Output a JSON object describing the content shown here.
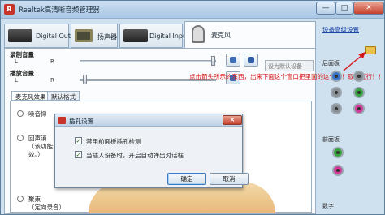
{
  "window": {
    "title": "Realtek高清晰音频管理器"
  },
  "device_tabs": [
    {
      "label": "Digital Output"
    },
    {
      "label": "扬声器"
    },
    {
      "label": "Digital Input"
    },
    {
      "label": "麦克风"
    }
  ],
  "right_panel": {
    "advanced_link": "设备高级设置",
    "rear_label": "后面板",
    "front_label": "前面板",
    "digital_label": "数字",
    "rear_jacks": [
      "#3b74c7",
      "#8a8f94",
      "#8a8f94",
      "#33a63a",
      "#8a8f94",
      "#d43a9a"
    ],
    "front_jacks": [
      "#33a63a",
      "#d43a9a"
    ]
  },
  "main": {
    "record_volume_label": "录制音量",
    "playback_volume_label": "播放音量",
    "left_label": "L",
    "right_label": "R",
    "default_device": "设为默认设备",
    "subtabs": [
      "麦克风效果",
      "默认格式"
    ],
    "effects": [
      {
        "text": "噪音抑"
      },
      {
        "text": "回声消"
      },
      {
        "text": "（该功能"
      },
      {
        "text": "效。）"
      },
      {
        "text": "聚束"
      },
      {
        "text": "（定向录音）"
      }
    ]
  },
  "annotation": "点击箭头所示的东西，出来下面这个窗口把里面的这个勾！取掉就行！！！",
  "dialog": {
    "title": "插孔设置",
    "close": "×",
    "options": [
      {
        "label": "禁用前面板插孔检测",
        "checked": true
      },
      {
        "label": "当插入设备时，开启自动弹出对话框",
        "checked": true
      }
    ],
    "ok_label": "确定",
    "cancel_label": "取消"
  },
  "colors": {
    "annotation": "#d81414",
    "close_button": "#c5402b"
  }
}
